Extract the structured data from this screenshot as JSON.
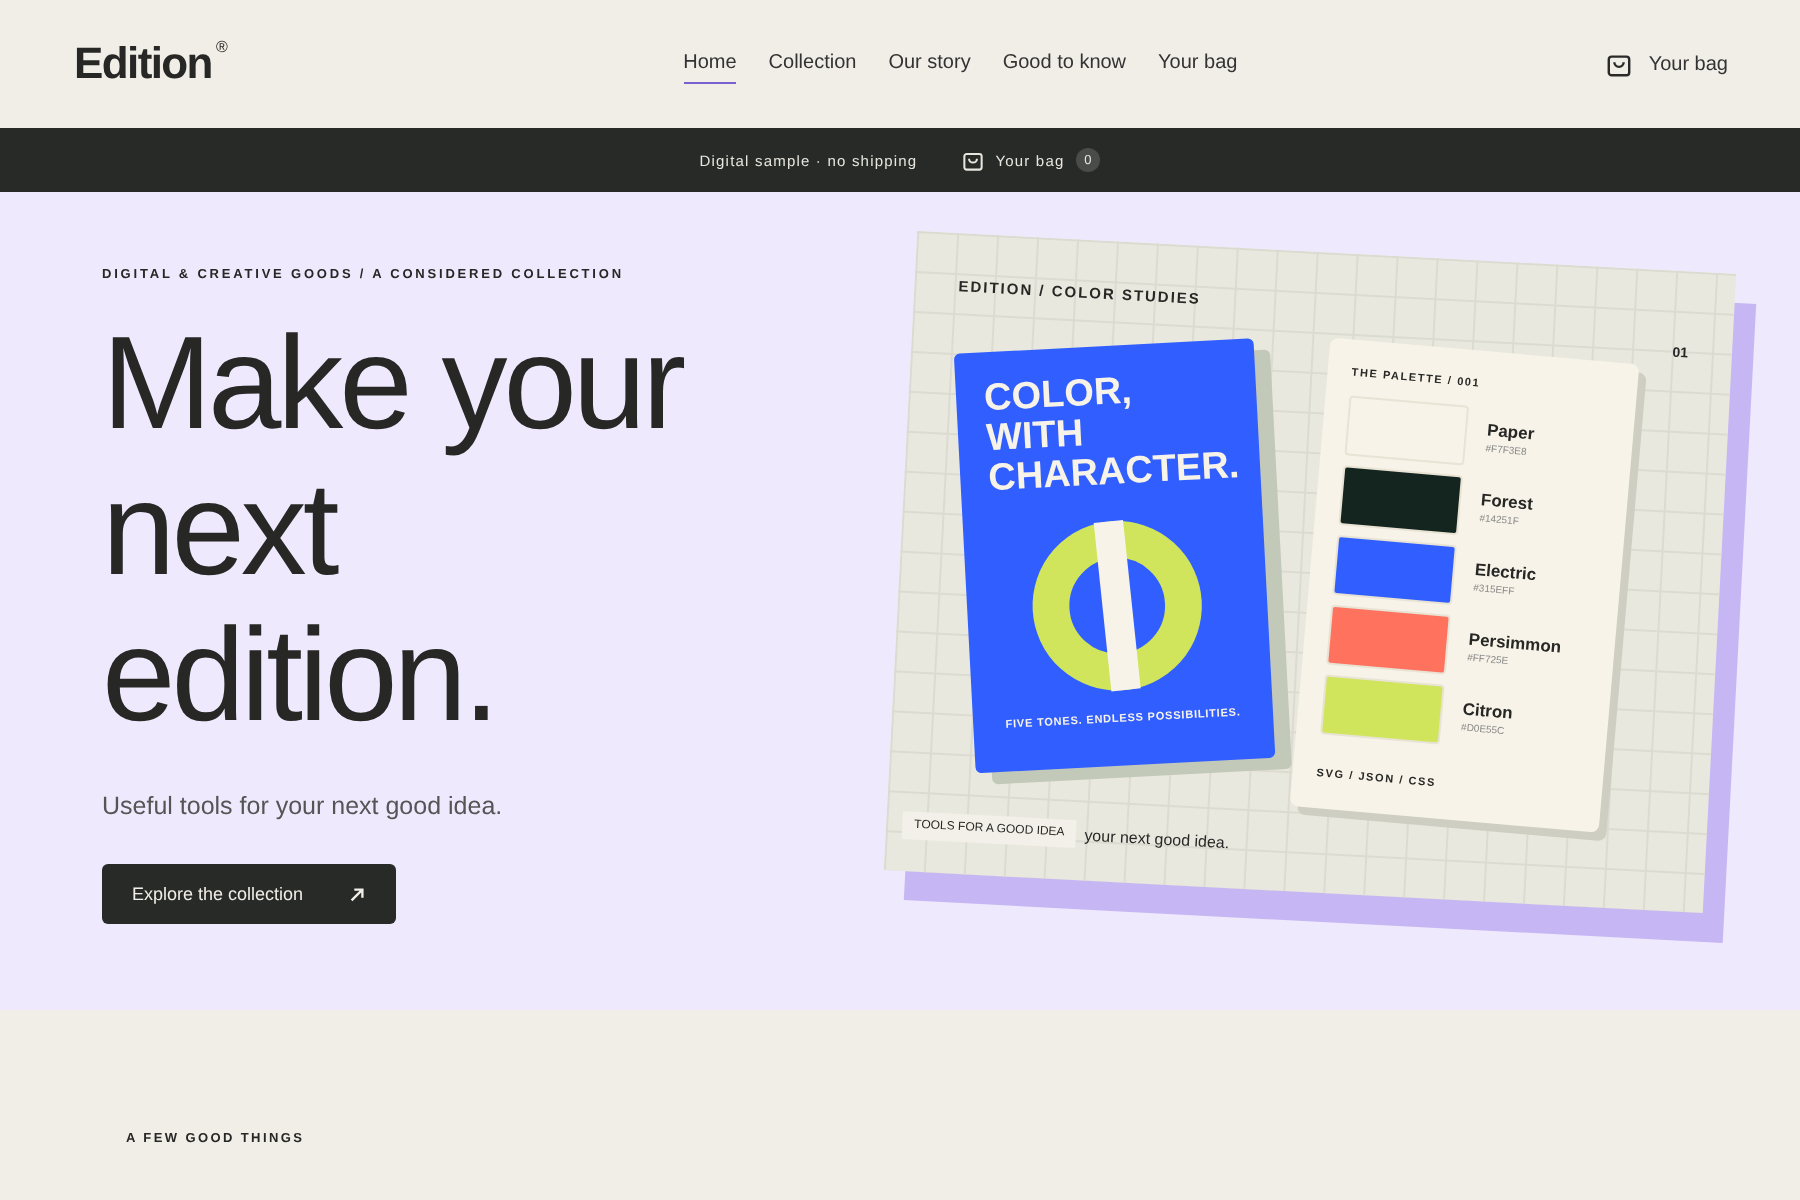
{
  "header": {
    "logo": "Edition",
    "logo_mark": "®",
    "nav": [
      {
        "label": "Home",
        "selected": true
      },
      {
        "label": "Collection",
        "selected": false
      },
      {
        "label": "Our story",
        "selected": false
      },
      {
        "label": "Good to know",
        "selected": false
      },
      {
        "label": "Your bag",
        "selected": false
      }
    ],
    "bag": "Your bag"
  },
  "notice_bar": {
    "text": "Digital sample · no shipping",
    "bag": "Your bag",
    "count": "0"
  },
  "hero": {
    "eyebrow": "DIGITAL & CREATIVE GOODS / A CONSIDERED COLLECTION",
    "headline": [
      "Make your",
      "next",
      "edition."
    ],
    "subtitle": "Useful tools for your next good idea.",
    "button": "Explore the collection",
    "artwork": {
      "title": "EDITION / COLOR STUDIES",
      "number": "01",
      "book": {
        "title": "COLOR, WITH CHARACTER.",
        "tagline": "FIVE TONES. ENDLESS POSSIBILITIES."
      },
      "palette": {
        "title": "THE PALETTE / 001",
        "swatches": [
          {
            "name": "Paper",
            "hex": "#F7F3E8",
            "color": "#f7f3e8"
          },
          {
            "name": "Forest",
            "hex": "#14251F",
            "color": "#14251f"
          },
          {
            "name": "Electric",
            "hex": "#315EFF",
            "color": "#315eff"
          },
          {
            "name": "Persimmon",
            "hex": "#FF725E",
            "color": "#ff725e"
          },
          {
            "name": "Citron",
            "hex": "#D0E55C",
            "color": "#d0e55c"
          }
        ],
        "formats": "SVG / JSON / CSS"
      },
      "tag": "TOOLS FOR A GOOD IDEA",
      "caption": "your next good idea."
    }
  },
  "section": {
    "eyebrow": "A FEW GOOD THINGS"
  }
}
